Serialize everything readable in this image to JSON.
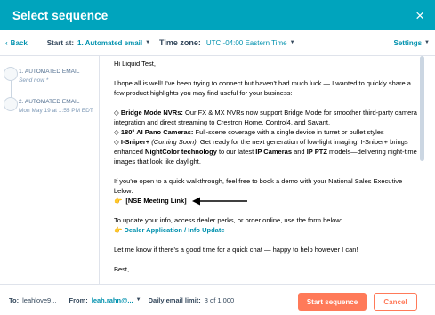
{
  "header": {
    "title": "Select sequence",
    "close_icon": "×"
  },
  "toolbar": {
    "back_label": "Back",
    "start_at_label": "Start at:",
    "start_at_value": "1. Automated email",
    "time_zone_label": "Time zone:",
    "time_zone_value": "UTC -04:00 Eastern Time",
    "settings_label": "Settings"
  },
  "sidebar": {
    "steps": [
      {
        "title": "1. AUTOMATED EMAIL",
        "subtitle": "Send now *"
      },
      {
        "title": "2. AUTOMATED EMAIL",
        "subtitle": "Mon May 19 at 1:55 PM EDT"
      }
    ]
  },
  "email": {
    "greeting": "Hi Liquid Test,",
    "intro": "I hope all is well! I've been trying to connect but haven't had much luck — I wanted to quickly share a few product highlights you may find useful for your business:",
    "b1_bullet": "◇",
    "b1_title": "Bridge Mode NVRs:",
    "b1_text": "Our FX & MX NVRs now support Bridge Mode for smoother third-party camera integration and  direct streaming to Crestron Home, Control4, and Savant.",
    "b2_bullet": "◇",
    "b2_title": "180° AI Pano Cameras:",
    "b2_text": "Full-scene coverage with a single device in turret or bullet styles",
    "b3_bullet": "◇",
    "b3_title": "I-Sniper+",
    "b3_soon": "(Coming Soon):",
    "b3_text1": "Get ready for the next generation of low-light imaging! I-Sniper+ brings enhanced",
    "b3_bold1": "NightColor technology",
    "b3_text2": "to our latest",
    "b3_bold2": "IP Cameras",
    "b3_text3": "and",
    "b3_bold3": "IP PTZ",
    "b3_text4": "models—delivering night-time images that look like daylight.",
    "walkthrough": "If you're open to a quick walkthrough, feel free to book a demo with your National Sales Executive below:",
    "pointer_emoji": "👉",
    "nse_link": "[NSE Meeting Link]",
    "update_text": "To update your info, access dealer perks, or order online, use the form below:",
    "dealer_link": "Dealer Application / Info Update",
    "closing": "Let me know if there's a good time for a quick chat — happy to help however I can!",
    "signoff": "Best,"
  },
  "footer": {
    "to_label": "To:",
    "to_value": "leahlove9...",
    "from_label": "From:",
    "from_value": "leah.rahn@...",
    "limit_label": "Daily email limit:",
    "limit_value": "3 of 1,000",
    "start_button": "Start sequence",
    "cancel_button": "Cancel"
  },
  "colors": {
    "header_bg": "#00a4bd",
    "link": "#0091ae",
    "primary_button": "#ff7a59",
    "text": "#33475b"
  }
}
